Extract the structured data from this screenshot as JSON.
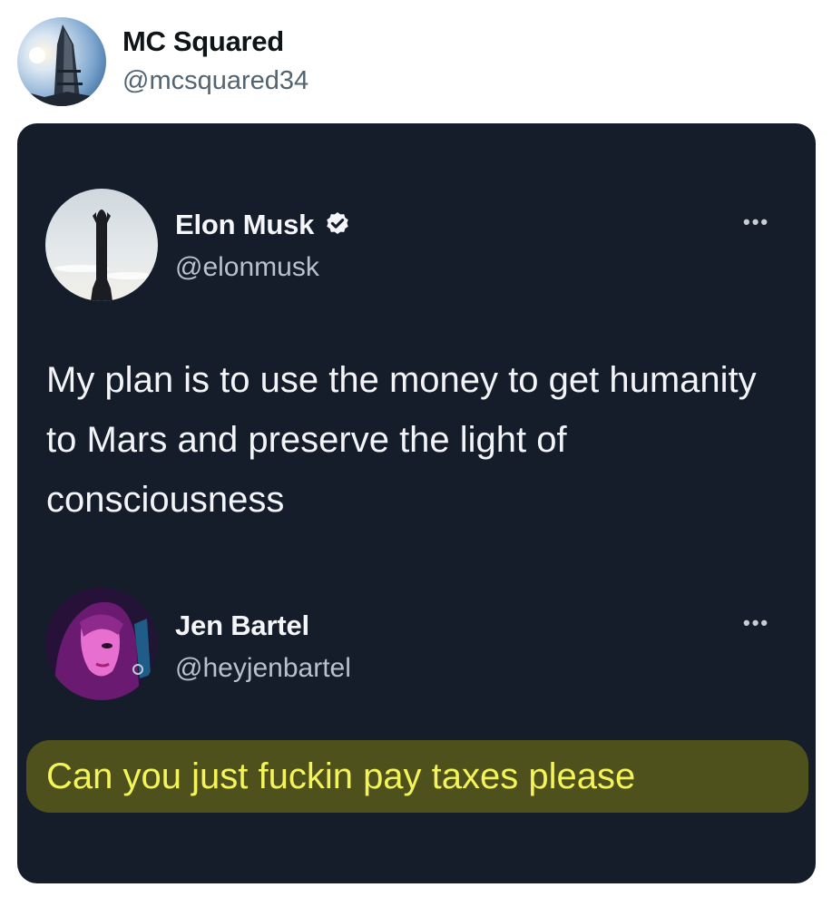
{
  "post": {
    "author_name": "MC Squared",
    "author_handle": "@mcsquared34",
    "avatar_icon": "sunset-tower-avatar"
  },
  "embedded": {
    "tweet": {
      "author_name": "Elon Musk",
      "author_handle": "@elonmusk",
      "verified": true,
      "avatar_icon": "rocket-avatar",
      "more_label": "•••",
      "text": "My plan is to use the money to get humanity to Mars and preserve the light of consciousness"
    },
    "reply": {
      "author_name": "Jen Bartel",
      "author_handle": "@heyjenbartel",
      "avatar_icon": "illustrated-woman-avatar",
      "more_label": "•••",
      "text": "Can you just fuckin pay taxes please",
      "highlight_color": "#f3f35a"
    },
    "background_color": "#151c2a"
  }
}
